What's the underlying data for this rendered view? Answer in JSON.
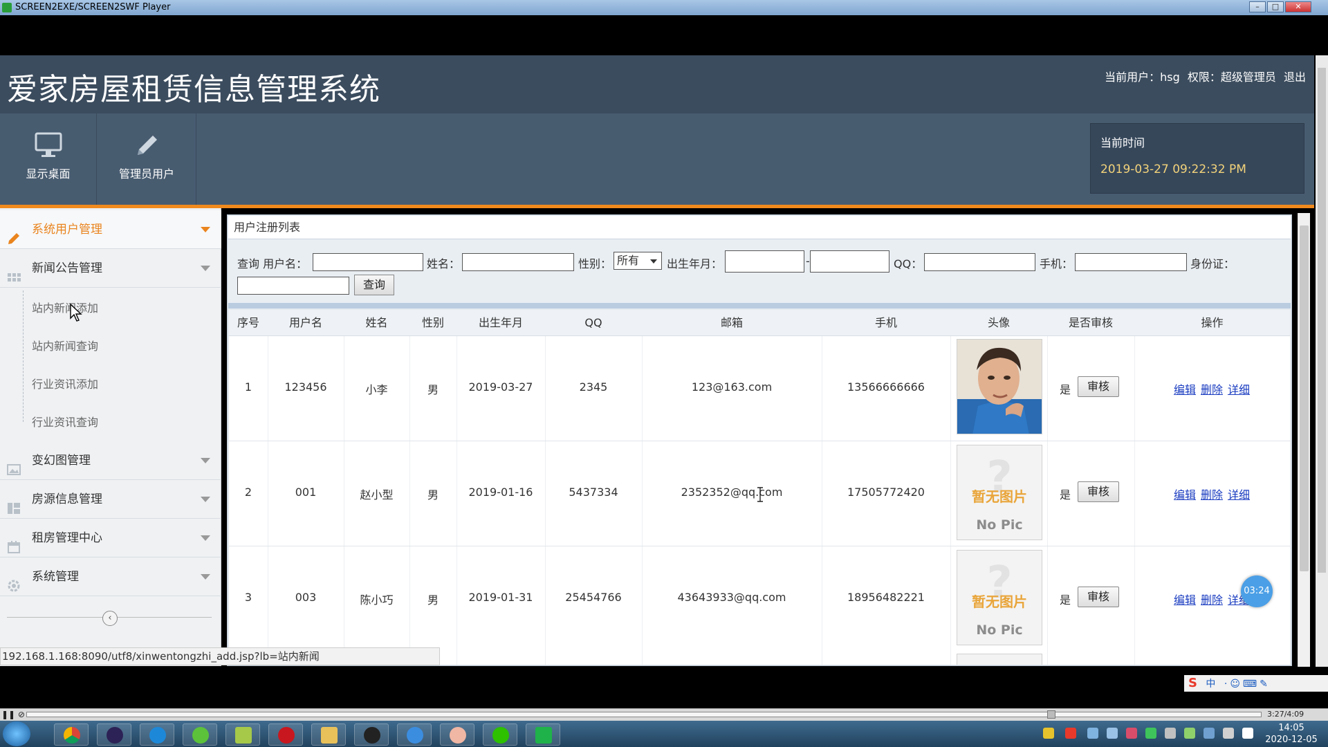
{
  "player": {
    "title": "SCREEN2EXE/SCREEN2SWF Player",
    "seek_time": "3:27/4:09",
    "timer": "03:24"
  },
  "app": {
    "title": "爱家房屋租赁信息管理系统",
    "current_user_label": "当前用户：hsg",
    "permission_label": "权限：超级管理员",
    "logout": "退出"
  },
  "nav": {
    "tiles": [
      {
        "label": "显示桌面"
      },
      {
        "label": "管理员用户"
      }
    ],
    "time_label": "当前时间",
    "time_value": "2019-03-27 09:22:32 PM"
  },
  "sidebar": {
    "items": [
      {
        "label": "系统用户管理"
      },
      {
        "label": "新闻公告管理"
      },
      {
        "label": "变幻图管理"
      },
      {
        "label": "房源信息管理"
      },
      {
        "label": "租房管理中心"
      },
      {
        "label": "系统管理"
      }
    ],
    "sub_items": [
      {
        "label": "站内新闻添加"
      },
      {
        "label": "站内新闻查询"
      },
      {
        "label": "行业资讯添加"
      },
      {
        "label": "行业资讯查询"
      }
    ],
    "collapse": "‹"
  },
  "panel": {
    "title": "用户注册列表"
  },
  "search": {
    "query_label": "查询 用户名：",
    "name_label": "姓名：",
    "sex_label": "性别：",
    "sex_value": "所有",
    "birth_label": "出生年月：",
    "dash": "-",
    "qq_label": "QQ：",
    "phone_label": "手机：",
    "id_label": "身份证：",
    "button": "查询"
  },
  "table": {
    "headers": [
      "序号",
      "用户名",
      "姓名",
      "性别",
      "出生年月",
      "QQ",
      "邮箱",
      "手机",
      "头像",
      "是否审核",
      "操作"
    ],
    "nopic_cn": "暂无图片",
    "nopic_en": "No Pic",
    "audit_button": "审核",
    "ops": [
      "编辑",
      "删除",
      "详细"
    ],
    "rows": [
      {
        "no": "1",
        "username": "123456",
        "name": "小李",
        "sex": "男",
        "birth": "2019-03-27",
        "qq": "2345",
        "email": "123@163.com",
        "phone": "13566666666",
        "avatar": "photo",
        "audited": "是"
      },
      {
        "no": "2",
        "username": "001",
        "name": "赵小型",
        "sex": "男",
        "birth": "2019-01-16",
        "qq": "5437334",
        "email": "2352352@qq.com",
        "phone": "17505772420",
        "avatar": "nopic",
        "audited": "是"
      },
      {
        "no": "3",
        "username": "003",
        "name": "陈小巧",
        "sex": "男",
        "birth": "2019-01-31",
        "qq": "25454766",
        "email": "43643933@qq.com",
        "phone": "18956482221",
        "avatar": "nopic",
        "audited": "是"
      }
    ]
  },
  "status": {
    "url": "192.168.1.168:8090/utf8/xinwentongzhi_add.jsp?lb=站内新闻"
  },
  "ime": {
    "logo": "S",
    "mode": "中"
  },
  "taskbar": {
    "time": "14:05",
    "date": "2020-12-05"
  },
  "colors": {
    "header": "#3b4c5e",
    "accent": "#f08a1d",
    "link": "#1a3cc0"
  }
}
